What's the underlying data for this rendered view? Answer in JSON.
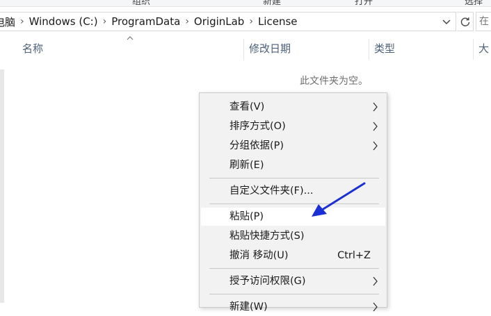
{
  "ribbon": {
    "items": [
      "组织",
      "新建",
      "打开",
      "选择"
    ]
  },
  "address": {
    "crumbs": [
      "电脑",
      "Windows (C:)",
      "ProgramData",
      "OriginLab",
      "License"
    ]
  },
  "search": {
    "placeholder": "在"
  },
  "columns": [
    {
      "label": "名称"
    },
    {
      "label": "修改日期"
    },
    {
      "label": "类型"
    },
    {
      "label": "大小"
    }
  ],
  "empty_message": "此文件夹为空。",
  "context_menu": {
    "items": [
      {
        "label": "查看(V)",
        "submenu": true
      },
      {
        "label": "排序方式(O)",
        "submenu": true
      },
      {
        "label": "分组依据(P)",
        "submenu": true
      },
      {
        "label": "刷新(E)"
      },
      {
        "label": "自定义文件夹(F)..."
      },
      {
        "label": "粘贴(P)",
        "highlighted": true
      },
      {
        "label": "粘贴快捷方式(S)"
      },
      {
        "label": "撤消 移动(U)",
        "shortcut": "Ctrl+Z"
      },
      {
        "label": "授予访问权限(G)",
        "submenu": true
      },
      {
        "label": "新建(W)",
        "submenu": true
      }
    ]
  },
  "colors": {
    "accent_arrow": "#1a2fd6",
    "header_text": "#4c607a",
    "menu_bg": "#f2f2f2"
  }
}
